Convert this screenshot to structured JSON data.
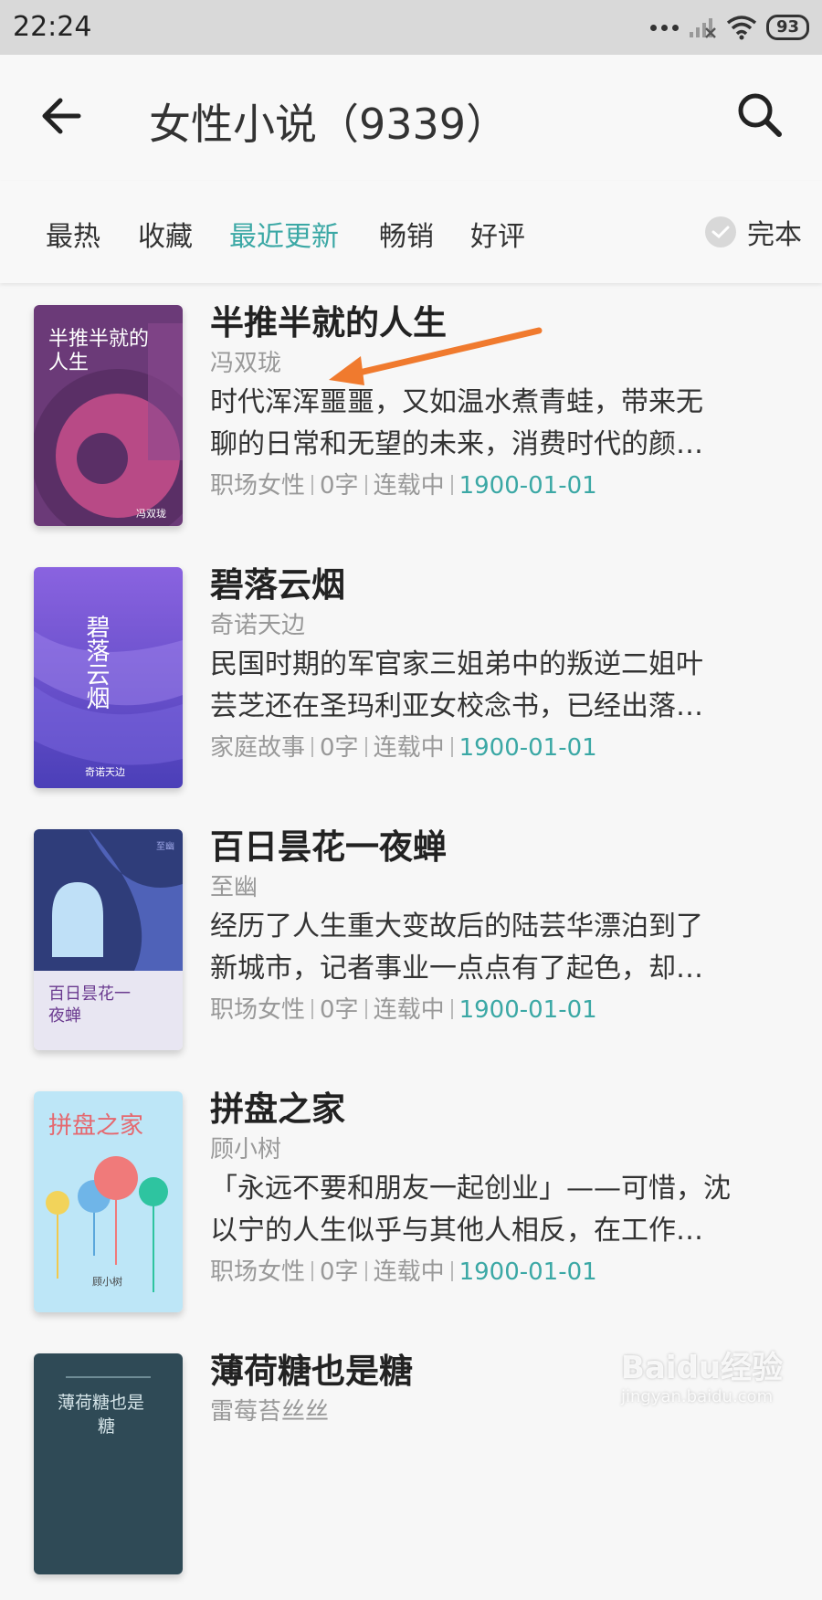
{
  "status_bar": {
    "time": "22:24",
    "battery": "93"
  },
  "header": {
    "title": "女性小说（9339）"
  },
  "filters": {
    "tabs": [
      {
        "label": "最热"
      },
      {
        "label": "收藏"
      },
      {
        "label": "最近更新",
        "active": true
      },
      {
        "label": "畅销"
      },
      {
        "label": "好评"
      }
    ],
    "complete_label": "完本"
  },
  "books": [
    {
      "title": "半推半就的人生",
      "author": "冯双珑",
      "desc_line1": "时代浑浑噩噩，又如温水煮青蛙，带来无",
      "desc_line2": "聊的日常和无望的未来，消费时代的颜…",
      "category": "职场女性",
      "words": "0字",
      "status": "连载中",
      "date": "1900-01-01",
      "cover_title_l1": "半推半就的",
      "cover_title_l2": "人生",
      "cover_author": "冯双珑"
    },
    {
      "title": "碧落云烟",
      "author": "奇诺天边",
      "desc_line1": "民国时期的军官家三姐弟中的叛逆二姐叶",
      "desc_line2": "芸芝还在圣玛利亚女校念书，已经出落…",
      "category": "家庭故事",
      "words": "0字",
      "status": "连载中",
      "date": "1900-01-01",
      "cover_title": "碧落云烟",
      "cover_author": "奇诺天边"
    },
    {
      "title": "百日昙花一夜蝉",
      "author": "至幽",
      "desc_line1": "经历了人生重大变故后的陆芸华漂泊到了",
      "desc_line2": "新城市，记者事业一点点有了起色，却…",
      "category": "职场女性",
      "words": "0字",
      "status": "连载中",
      "date": "1900-01-01",
      "cover_title_l1": "百日昙花一",
      "cover_title_l2": "夜蝉",
      "cover_author": "至幽"
    },
    {
      "title": "拼盘之家",
      "author": "顾小树",
      "desc_line1": "「永远不要和朋友一起创业」——可惜，沈",
      "desc_line2": "以宁的人生似乎与其他人相反，在工作…",
      "category": "职场女性",
      "words": "0字",
      "status": "连载中",
      "date": "1900-01-01",
      "cover_title": "拼盘之家",
      "cover_author": "顾小树"
    },
    {
      "title": "薄荷糖也是糖",
      "author": "雷莓苔丝丝",
      "cover_title_l1": "薄荷糖也是",
      "cover_title_l2": "糖"
    }
  ],
  "watermark": {
    "logo": "Baidu经验",
    "url": "jingyan.baidu.com"
  },
  "colors": {
    "accent": "#3ba8a5",
    "arrow": "#f07a2e"
  },
  "icons": [
    "back-arrow-icon",
    "search-icon",
    "check-icon",
    "wifi-icon",
    "signal-icon"
  ]
}
